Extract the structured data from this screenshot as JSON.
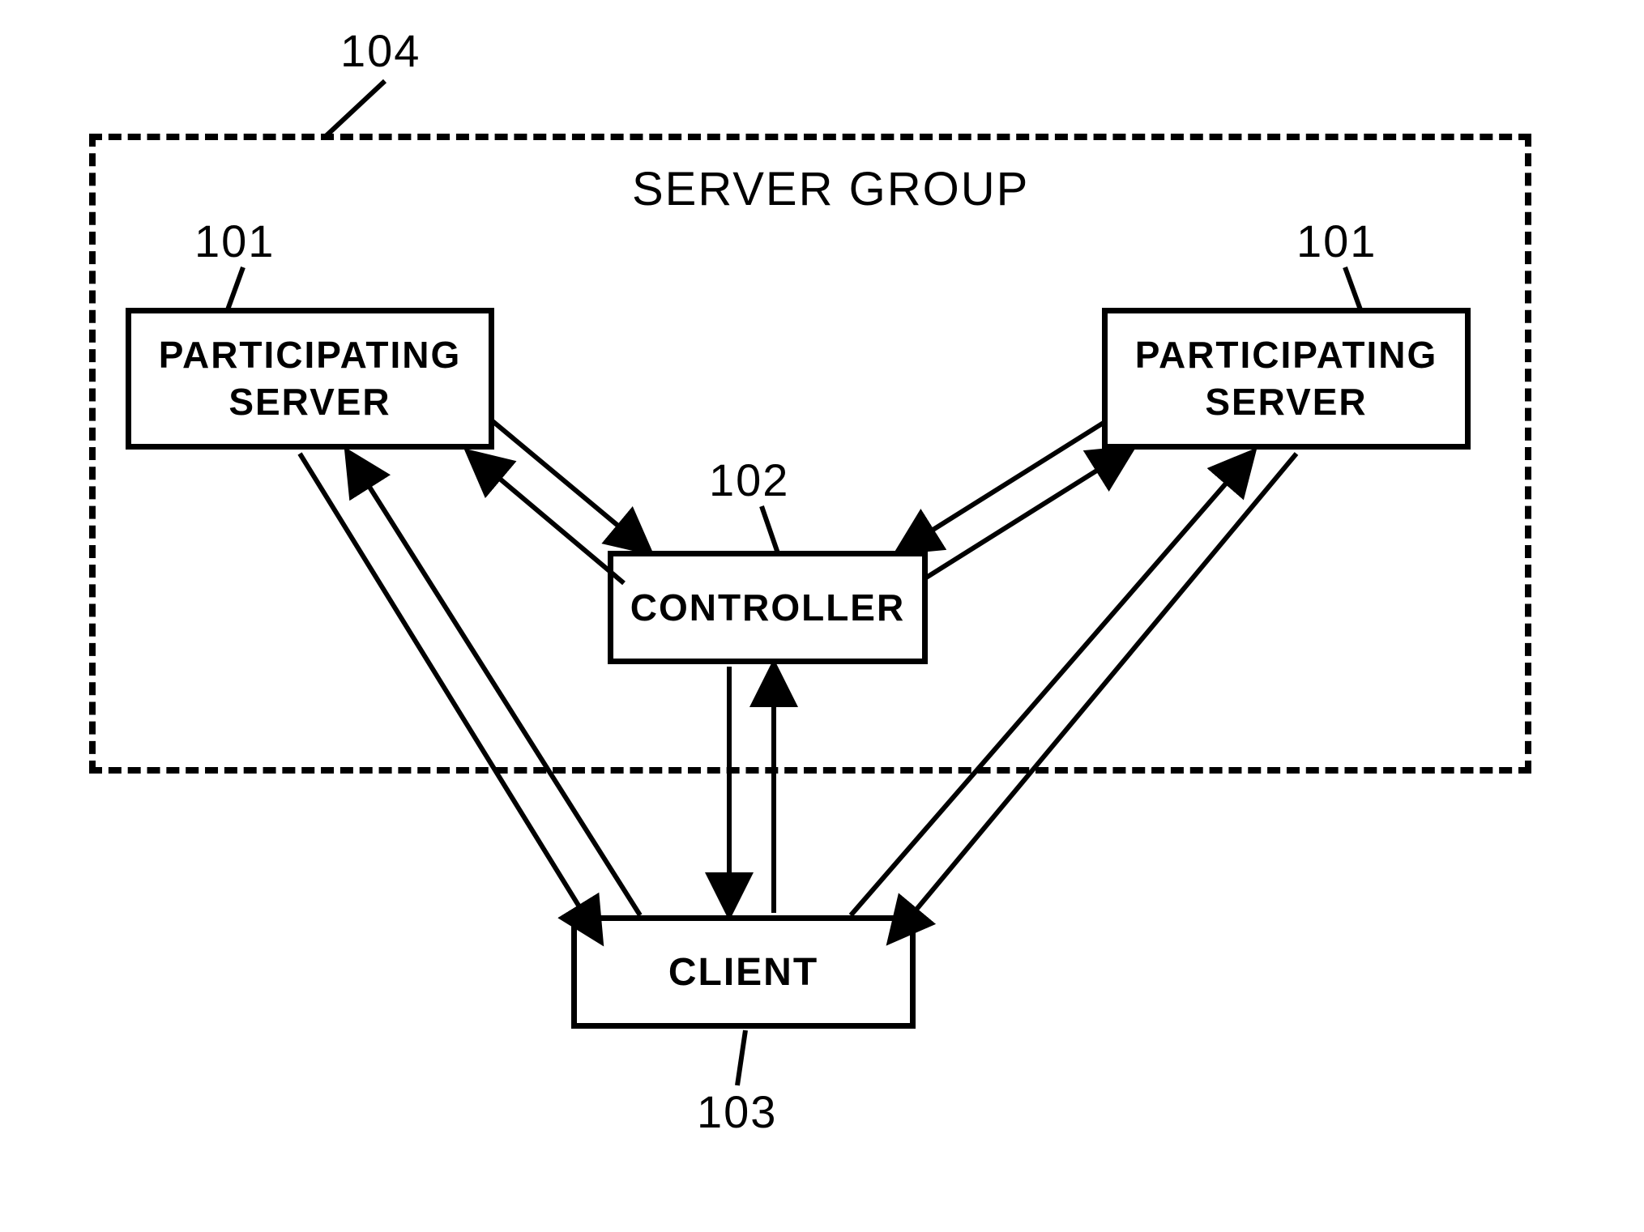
{
  "diagram": {
    "group": {
      "ref": "104",
      "title": "SERVER GROUP"
    },
    "nodes": {
      "server_left": {
        "ref": "101",
        "label_line1": "PARTICIPATING",
        "label_line2": "SERVER"
      },
      "server_right": {
        "ref": "101",
        "label_line1": "PARTICIPATING",
        "label_line2": "SERVER"
      },
      "controller": {
        "ref": "102",
        "label": "CONTROLLER"
      },
      "client": {
        "ref": "103",
        "label": "CLIENT"
      }
    },
    "connections": [
      {
        "from": "server_left",
        "to": "controller",
        "bidirectional": true
      },
      {
        "from": "server_right",
        "to": "controller",
        "bidirectional": true
      },
      {
        "from": "controller",
        "to": "client",
        "bidirectional": true
      },
      {
        "from": "server_left",
        "to": "client",
        "bidirectional": true
      },
      {
        "from": "server_right",
        "to": "client",
        "bidirectional": true
      }
    ]
  }
}
